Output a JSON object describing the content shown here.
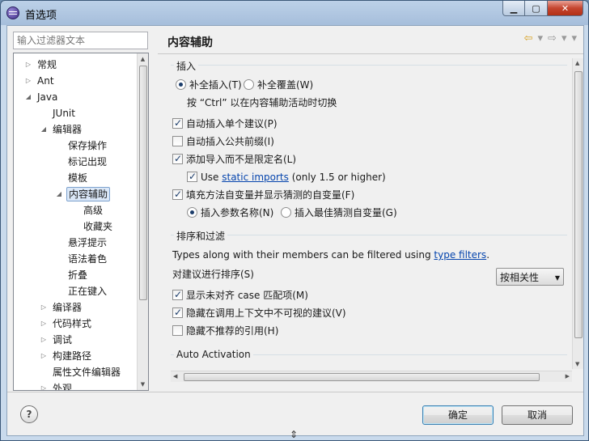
{
  "window": {
    "title": "首选项"
  },
  "filter": {
    "placeholder": "输入过滤器文本"
  },
  "tree": {
    "items": [
      {
        "label": "常规",
        "arrow": "▷"
      },
      {
        "label": "Ant",
        "arrow": "▷"
      },
      {
        "label": "Java",
        "arrow": "◢"
      },
      {
        "label": "JUnit",
        "arrow": ""
      },
      {
        "label": "编辑器",
        "arrow": "◢"
      },
      {
        "label": "保存操作",
        "arrow": ""
      },
      {
        "label": "标记出现",
        "arrow": ""
      },
      {
        "label": "模板",
        "arrow": ""
      },
      {
        "label": "内容辅助",
        "arrow": "◢"
      },
      {
        "label": "高级",
        "arrow": ""
      },
      {
        "label": "收藏夹",
        "arrow": ""
      },
      {
        "label": "悬浮提示",
        "arrow": ""
      },
      {
        "label": "语法着色",
        "arrow": ""
      },
      {
        "label": "折叠",
        "arrow": ""
      },
      {
        "label": "正在键入",
        "arrow": ""
      },
      {
        "label": "编译器",
        "arrow": "▷"
      },
      {
        "label": "代码样式",
        "arrow": "▷"
      },
      {
        "label": "调试",
        "arrow": "▷"
      },
      {
        "label": "构建路径",
        "arrow": "▷"
      },
      {
        "label": "属性文件编辑器",
        "arrow": ""
      },
      {
        "label": "外观",
        "arrow": "▷"
      }
    ]
  },
  "page": {
    "title": "内容辅助"
  },
  "insert": {
    "title": "插入",
    "radio_complete": "补全插入(T)",
    "radio_overwrite": "补全覆盖(W)",
    "hint": "按 “Ctrl” 以在内容辅助活动时切换",
    "auto_single": "自动插入单个建议(P)",
    "auto_prefix": "自动插入公共前缀(I)",
    "add_import": "添加导入而不是限定名(L)",
    "use_prefix": "Use ",
    "static_imports": "static imports",
    "use_suffix": " (only 1.5 or higher)",
    "fill_args": "填充方法自变量并显示猜测的自变量(F)",
    "insert_param_names": "插入参数名称(N)",
    "insert_best_guess": "插入最佳猜测自变量(G)"
  },
  "sorting": {
    "title": "排序和过滤",
    "types_text": "Types along with their members can be filtered using ",
    "type_filters": "type filters",
    "period": ".",
    "sort_label": "对建议进行排序(S)",
    "sort_value": "按相关性",
    "show_camel": "显示未对齐 case 匹配项(M)",
    "hide_invisible": "隐藏在调用上下文中不可视的建议(V)",
    "hide_deprecated": "隐藏不推荐的引用(H)"
  },
  "auto_activation": {
    "title": "Auto Activation"
  },
  "buttons": {
    "ok": "确定",
    "cancel": "取消",
    "help": "?"
  }
}
